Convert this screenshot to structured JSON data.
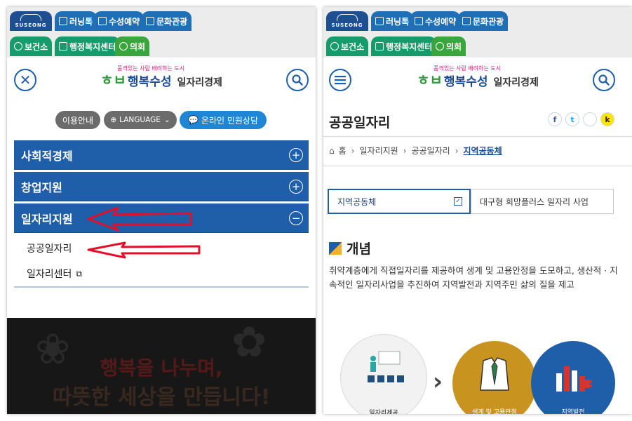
{
  "tabs_row1": [
    "러닝톡",
    "수성예약",
    "문화관광"
  ],
  "tabs_row2": [
    "보건소",
    "행정복지센터",
    "의회"
  ],
  "logo_text": "SUSEONG",
  "brand": {
    "slogan": "품격있는 사람 배려하는 도시",
    "mark": "행복수성",
    "section": "일자리경제"
  },
  "left": {
    "utility": {
      "guide": "이용안내",
      "language": "LANGUAGE",
      "consult": "온라인 민원상담"
    },
    "menu": [
      {
        "label": "사회적경제",
        "state": "+"
      },
      {
        "label": "창업지원",
        "state": "+"
      },
      {
        "label": "일자리지원",
        "state": "−"
      }
    ],
    "submenu": [
      "공공일자리",
      "일자리센터"
    ],
    "banner": {
      "line1": "행복을 나누며,",
      "line2": "따뜻한 세상을 만듭니다!"
    }
  },
  "right": {
    "page_title": "공공일자리",
    "share": [
      "f",
      "t",
      "",
      "k"
    ],
    "breadcrumb": [
      "홈",
      "일자리지원",
      "공공일자리",
      "지역공동체"
    ],
    "sel_tabs": [
      "지역공동체",
      "대구형 희망플러스 일자리 사업"
    ],
    "concept_title": "개념",
    "concept_desc": "취약계층에게 직접일자리를 제공하여 생계 및 고용안정을 도모하고, 생산적 · 지속적인 일자리사업을 추진하여 지역발전과 지역주민 삶의 질을 제고",
    "circles": [
      "일자리제공",
      "생계 및 고용안정",
      "지역발전"
    ]
  },
  "colors": {
    "primary": "#1f5fa9",
    "arrow": "#e0102a",
    "circle1": "#f2f2f2",
    "circle2": "#c8941f",
    "circle3": "#1f5ea8"
  }
}
